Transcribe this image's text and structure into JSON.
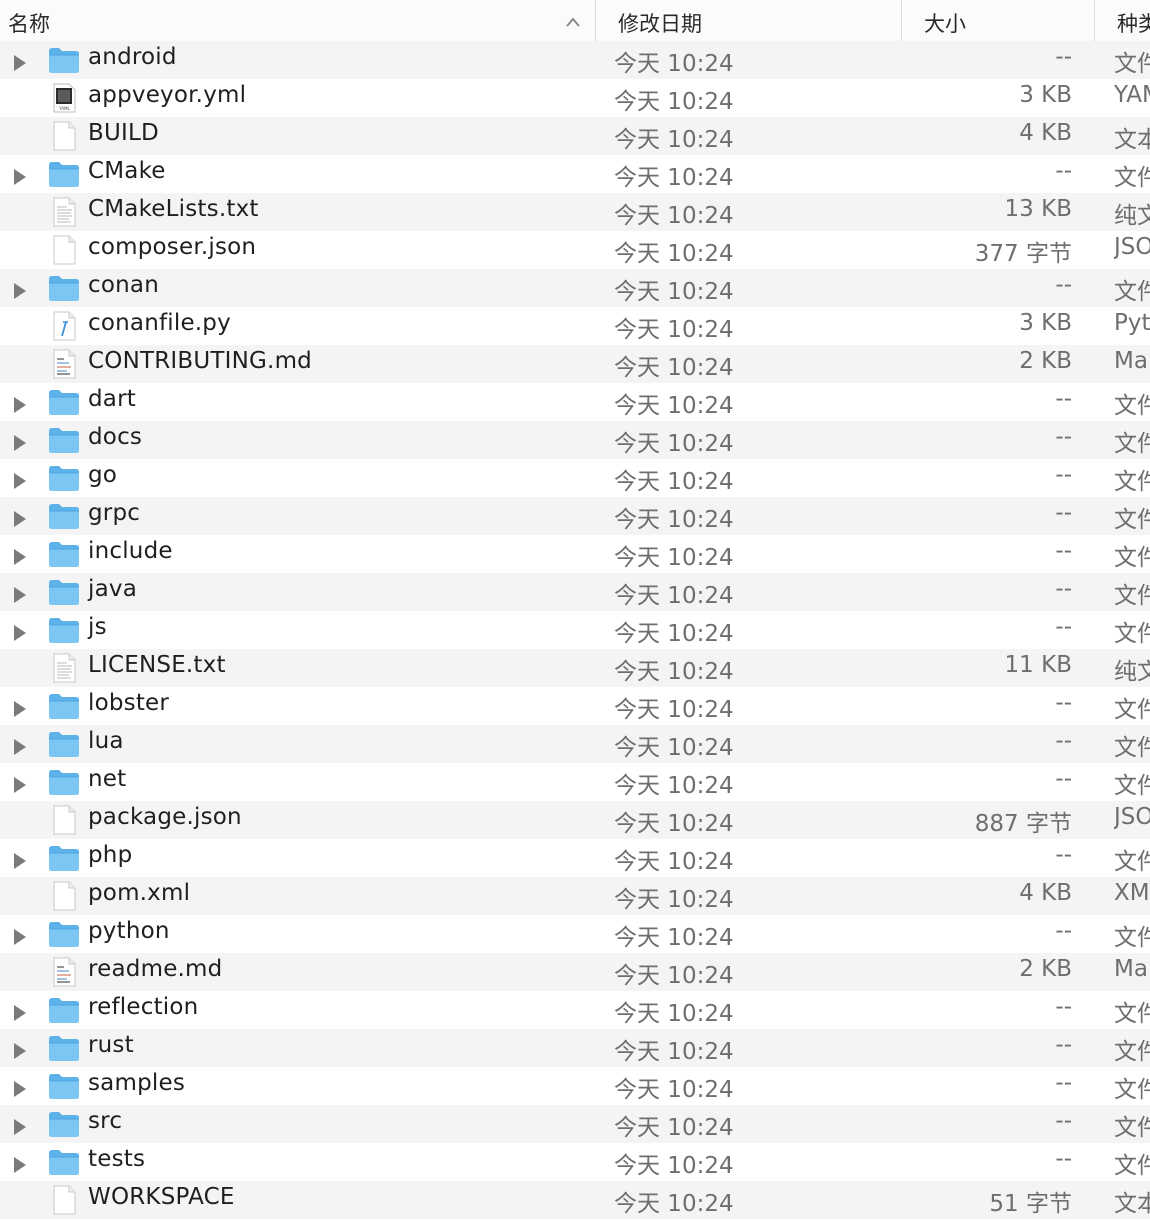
{
  "columns": {
    "name": "名称",
    "date": "修改日期",
    "size": "大小",
    "kind": "种类"
  },
  "rows": [
    {
      "name": "android",
      "type": "folder",
      "date": "今天 10:24",
      "size": "--",
      "kind": "文件夹"
    },
    {
      "name": "appveyor.yml",
      "type": "yaml",
      "date": "今天 10:24",
      "size": "3 KB",
      "kind": "YAML"
    },
    {
      "name": "BUILD",
      "type": "blank",
      "date": "今天 10:24",
      "size": "4 KB",
      "kind": "文本"
    },
    {
      "name": "CMake",
      "type": "folder",
      "date": "今天 10:24",
      "size": "--",
      "kind": "文件夹"
    },
    {
      "name": "CMakeLists.txt",
      "type": "text",
      "date": "今天 10:24",
      "size": "13 KB",
      "kind": "纯文本"
    },
    {
      "name": "composer.json",
      "type": "blank",
      "date": "今天 10:24",
      "size": "377 字节",
      "kind": "JSON"
    },
    {
      "name": "conan",
      "type": "folder",
      "date": "今天 10:24",
      "size": "--",
      "kind": "文件夹"
    },
    {
      "name": "conanfile.py",
      "type": "python",
      "date": "今天 10:24",
      "size": "3 KB",
      "kind": "Python"
    },
    {
      "name": "CONTRIBUTING.md",
      "type": "markdown",
      "date": "今天 10:24",
      "size": "2 KB",
      "kind": "Markdown"
    },
    {
      "name": "dart",
      "type": "folder",
      "date": "今天 10:24",
      "size": "--",
      "kind": "文件夹"
    },
    {
      "name": "docs",
      "type": "folder",
      "date": "今天 10:24",
      "size": "--",
      "kind": "文件夹"
    },
    {
      "name": "go",
      "type": "folder",
      "date": "今天 10:24",
      "size": "--",
      "kind": "文件夹"
    },
    {
      "name": "grpc",
      "type": "folder",
      "date": "今天 10:24",
      "size": "--",
      "kind": "文件夹"
    },
    {
      "name": "include",
      "type": "folder",
      "date": "今天 10:24",
      "size": "--",
      "kind": "文件夹"
    },
    {
      "name": "java",
      "type": "folder",
      "date": "今天 10:24",
      "size": "--",
      "kind": "文件夹"
    },
    {
      "name": "js",
      "type": "folder",
      "date": "今天 10:24",
      "size": "--",
      "kind": "文件夹"
    },
    {
      "name": "LICENSE.txt",
      "type": "text",
      "date": "今天 10:24",
      "size": "11 KB",
      "kind": "纯文本"
    },
    {
      "name": "lobster",
      "type": "folder",
      "date": "今天 10:24",
      "size": "--",
      "kind": "文件夹"
    },
    {
      "name": "lua",
      "type": "folder",
      "date": "今天 10:24",
      "size": "--",
      "kind": "文件夹"
    },
    {
      "name": "net",
      "type": "folder",
      "date": "今天 10:24",
      "size": "--",
      "kind": "文件夹"
    },
    {
      "name": "package.json",
      "type": "blank",
      "date": "今天 10:24",
      "size": "887 字节",
      "kind": "JSON"
    },
    {
      "name": "php",
      "type": "folder",
      "date": "今天 10:24",
      "size": "--",
      "kind": "文件夹"
    },
    {
      "name": "pom.xml",
      "type": "blank",
      "date": "今天 10:24",
      "size": "4 KB",
      "kind": "XML"
    },
    {
      "name": "python",
      "type": "folder",
      "date": "今天 10:24",
      "size": "--",
      "kind": "文件夹"
    },
    {
      "name": "readme.md",
      "type": "markdown",
      "date": "今天 10:24",
      "size": "2 KB",
      "kind": "Markdown"
    },
    {
      "name": "reflection",
      "type": "folder",
      "date": "今天 10:24",
      "size": "--",
      "kind": "文件夹"
    },
    {
      "name": "rust",
      "type": "folder",
      "date": "今天 10:24",
      "size": "--",
      "kind": "文件夹"
    },
    {
      "name": "samples",
      "type": "folder",
      "date": "今天 10:24",
      "size": "--",
      "kind": "文件夹"
    },
    {
      "name": "src",
      "type": "folder",
      "date": "今天 10:24",
      "size": "--",
      "kind": "文件夹"
    },
    {
      "name": "tests",
      "type": "folder",
      "date": "今天 10:24",
      "size": "--",
      "kind": "文件夹"
    },
    {
      "name": "WORKSPACE",
      "type": "blank",
      "date": "今天 10:24",
      "size": "51 字节",
      "kind": "文本"
    }
  ]
}
